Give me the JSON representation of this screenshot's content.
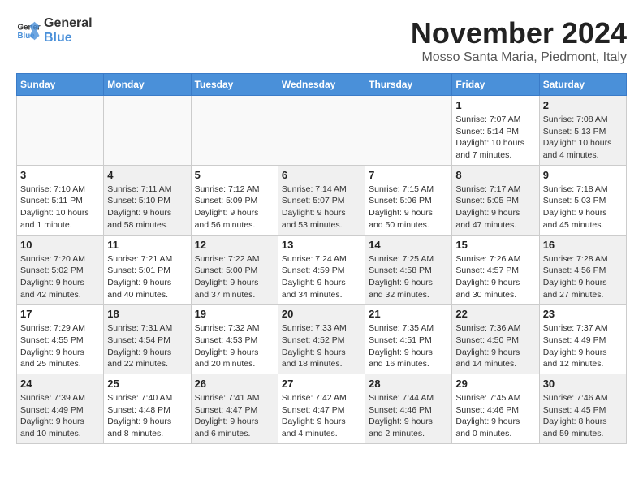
{
  "logo": {
    "general": "General",
    "blue": "Blue"
  },
  "title": {
    "month": "November 2024",
    "location": "Mosso Santa Maria, Piedmont, Italy"
  },
  "weekdays": [
    "Sunday",
    "Monday",
    "Tuesday",
    "Wednesday",
    "Thursday",
    "Friday",
    "Saturday"
  ],
  "weeks": [
    [
      {
        "day": "",
        "info": ""
      },
      {
        "day": "",
        "info": ""
      },
      {
        "day": "",
        "info": ""
      },
      {
        "day": "",
        "info": ""
      },
      {
        "day": "",
        "info": ""
      },
      {
        "day": "1",
        "info": "Sunrise: 7:07 AM\nSunset: 5:14 PM\nDaylight: 10 hours and 7 minutes."
      },
      {
        "day": "2",
        "info": "Sunrise: 7:08 AM\nSunset: 5:13 PM\nDaylight: 10 hours and 4 minutes."
      }
    ],
    [
      {
        "day": "3",
        "info": "Sunrise: 7:10 AM\nSunset: 5:11 PM\nDaylight: 10 hours and 1 minute."
      },
      {
        "day": "4",
        "info": "Sunrise: 7:11 AM\nSunset: 5:10 PM\nDaylight: 9 hours and 58 minutes."
      },
      {
        "day": "5",
        "info": "Sunrise: 7:12 AM\nSunset: 5:09 PM\nDaylight: 9 hours and 56 minutes."
      },
      {
        "day": "6",
        "info": "Sunrise: 7:14 AM\nSunset: 5:07 PM\nDaylight: 9 hours and 53 minutes."
      },
      {
        "day": "7",
        "info": "Sunrise: 7:15 AM\nSunset: 5:06 PM\nDaylight: 9 hours and 50 minutes."
      },
      {
        "day": "8",
        "info": "Sunrise: 7:17 AM\nSunset: 5:05 PM\nDaylight: 9 hours and 47 minutes."
      },
      {
        "day": "9",
        "info": "Sunrise: 7:18 AM\nSunset: 5:03 PM\nDaylight: 9 hours and 45 minutes."
      }
    ],
    [
      {
        "day": "10",
        "info": "Sunrise: 7:20 AM\nSunset: 5:02 PM\nDaylight: 9 hours and 42 minutes."
      },
      {
        "day": "11",
        "info": "Sunrise: 7:21 AM\nSunset: 5:01 PM\nDaylight: 9 hours and 40 minutes."
      },
      {
        "day": "12",
        "info": "Sunrise: 7:22 AM\nSunset: 5:00 PM\nDaylight: 9 hours and 37 minutes."
      },
      {
        "day": "13",
        "info": "Sunrise: 7:24 AM\nSunset: 4:59 PM\nDaylight: 9 hours and 34 minutes."
      },
      {
        "day": "14",
        "info": "Sunrise: 7:25 AM\nSunset: 4:58 PM\nDaylight: 9 hours and 32 minutes."
      },
      {
        "day": "15",
        "info": "Sunrise: 7:26 AM\nSunset: 4:57 PM\nDaylight: 9 hours and 30 minutes."
      },
      {
        "day": "16",
        "info": "Sunrise: 7:28 AM\nSunset: 4:56 PM\nDaylight: 9 hours and 27 minutes."
      }
    ],
    [
      {
        "day": "17",
        "info": "Sunrise: 7:29 AM\nSunset: 4:55 PM\nDaylight: 9 hours and 25 minutes."
      },
      {
        "day": "18",
        "info": "Sunrise: 7:31 AM\nSunset: 4:54 PM\nDaylight: 9 hours and 22 minutes."
      },
      {
        "day": "19",
        "info": "Sunrise: 7:32 AM\nSunset: 4:53 PM\nDaylight: 9 hours and 20 minutes."
      },
      {
        "day": "20",
        "info": "Sunrise: 7:33 AM\nSunset: 4:52 PM\nDaylight: 9 hours and 18 minutes."
      },
      {
        "day": "21",
        "info": "Sunrise: 7:35 AM\nSunset: 4:51 PM\nDaylight: 9 hours and 16 minutes."
      },
      {
        "day": "22",
        "info": "Sunrise: 7:36 AM\nSunset: 4:50 PM\nDaylight: 9 hours and 14 minutes."
      },
      {
        "day": "23",
        "info": "Sunrise: 7:37 AM\nSunset: 4:49 PM\nDaylight: 9 hours and 12 minutes."
      }
    ],
    [
      {
        "day": "24",
        "info": "Sunrise: 7:39 AM\nSunset: 4:49 PM\nDaylight: 9 hours and 10 minutes."
      },
      {
        "day": "25",
        "info": "Sunrise: 7:40 AM\nSunset: 4:48 PM\nDaylight: 9 hours and 8 minutes."
      },
      {
        "day": "26",
        "info": "Sunrise: 7:41 AM\nSunset: 4:47 PM\nDaylight: 9 hours and 6 minutes."
      },
      {
        "day": "27",
        "info": "Sunrise: 7:42 AM\nSunset: 4:47 PM\nDaylight: 9 hours and 4 minutes."
      },
      {
        "day": "28",
        "info": "Sunrise: 7:44 AM\nSunset: 4:46 PM\nDaylight: 9 hours and 2 minutes."
      },
      {
        "day": "29",
        "info": "Sunrise: 7:45 AM\nSunset: 4:46 PM\nDaylight: 9 hours and 0 minutes."
      },
      {
        "day": "30",
        "info": "Sunrise: 7:46 AM\nSunset: 4:45 PM\nDaylight: 8 hours and 59 minutes."
      }
    ]
  ]
}
